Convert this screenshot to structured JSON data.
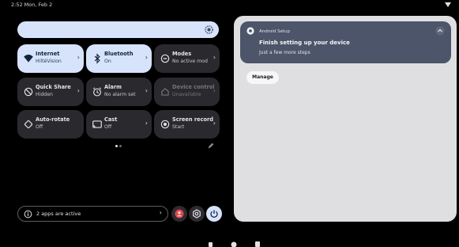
{
  "status_bar": {
    "time_date": "2:52 Mon, Feb 2",
    "signal_icon": "signal-icon"
  },
  "brightness": {
    "icon": "brightness-icon",
    "level": 1.0
  },
  "tiles": [
    {
      "label": "Internet",
      "sublabel": "HiltéVision",
      "icon": "wifi-icon",
      "state": "on",
      "has_chevron": true
    },
    {
      "label": "Bluetooth",
      "sublabel": "On",
      "icon": "bluetooth-icon",
      "state": "on",
      "has_chevron": true
    },
    {
      "label": "Modes",
      "sublabel": "No active mod",
      "icon": "do-not-disturb-icon",
      "state": "idle",
      "has_chevron": true
    },
    {
      "label": "Quick Share",
      "sublabel": "Hidden",
      "icon": "quick-share-icon",
      "state": "idle",
      "has_chevron": true
    },
    {
      "label": "Alarm",
      "sublabel": "No alarm set",
      "icon": "alarm-icon",
      "state": "idle",
      "has_chevron": true
    },
    {
      "label": "Device control",
      "sublabel": "Unavailable",
      "icon": "home-icon",
      "state": "unavailable",
      "has_chevron": true
    },
    {
      "label": "Auto-rotate",
      "sublabel": "Off",
      "icon": "rotate-icon",
      "state": "idle",
      "has_chevron": false
    },
    {
      "label": "Cast",
      "sublabel": "Off",
      "icon": "cast-icon",
      "state": "idle",
      "has_chevron": true
    },
    {
      "label": "Screen record",
      "sublabel": "Start",
      "icon": "screen-record-icon",
      "state": "idle",
      "has_chevron": true
    }
  ],
  "pagination": {
    "pages": 2,
    "current": 1
  },
  "edit_icon": "pencil-icon",
  "active_apps": {
    "text": "2 apps are active",
    "icon": "info-icon"
  },
  "round_buttons": [
    {
      "icon": "user-icon",
      "color": "#e2454b"
    },
    {
      "icon": "settings-icon",
      "color": "#e6e1e5"
    },
    {
      "icon": "power-icon",
      "color": "#d6e3fa"
    }
  ],
  "notification": {
    "app": "Android Setup",
    "title": "Finish setting up your device",
    "body": "Just a few more steps",
    "action": "Manage",
    "app_icon": "android-setup-icon",
    "collapse_icon": "chevron-up-icon"
  },
  "colors": {
    "accent_tile": "#d6e3fa",
    "tile_bg": "#2a2a2e",
    "panel_bg": "#dfdfe2",
    "notification_bg": "#4c5569"
  }
}
